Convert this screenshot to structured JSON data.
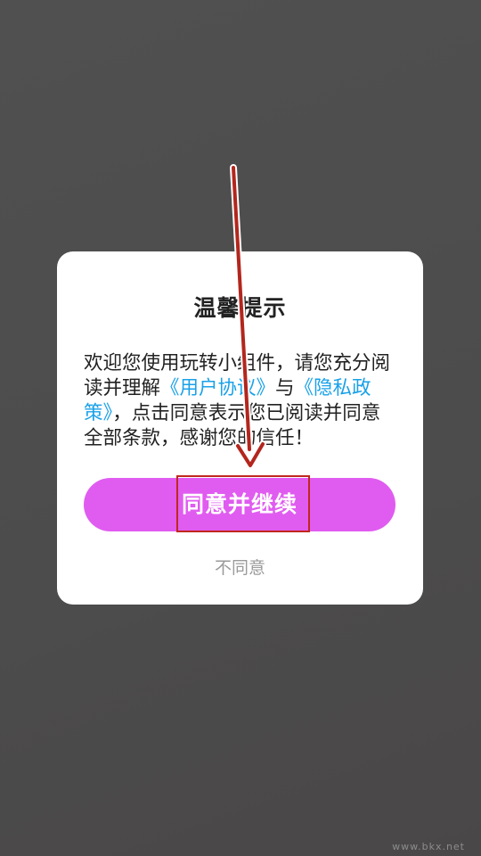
{
  "dialog": {
    "title": "温馨提示",
    "body_prefix": "欢迎您使用玩转小组件，请您充分阅读并理解",
    "user_agreement_link": "《用户协议》",
    "connector": "与",
    "privacy_policy_link": "《隐私政策》",
    "body_suffix": "，点击同意表示您已阅读并同意全部条款，感谢您的信任！",
    "agree_button_label": "同意并继续",
    "disagree_label": "不同意"
  },
  "watermark": "www.bkx.net",
  "colors": {
    "overlay": "#4f4f4f",
    "accent_button": "#e05cf0",
    "link": "#1aa1e8",
    "annotation": "#c0281e",
    "secondary_text": "#9a9a9a"
  },
  "icons": {
    "annotation_arrow": "arrow-down-icon"
  }
}
